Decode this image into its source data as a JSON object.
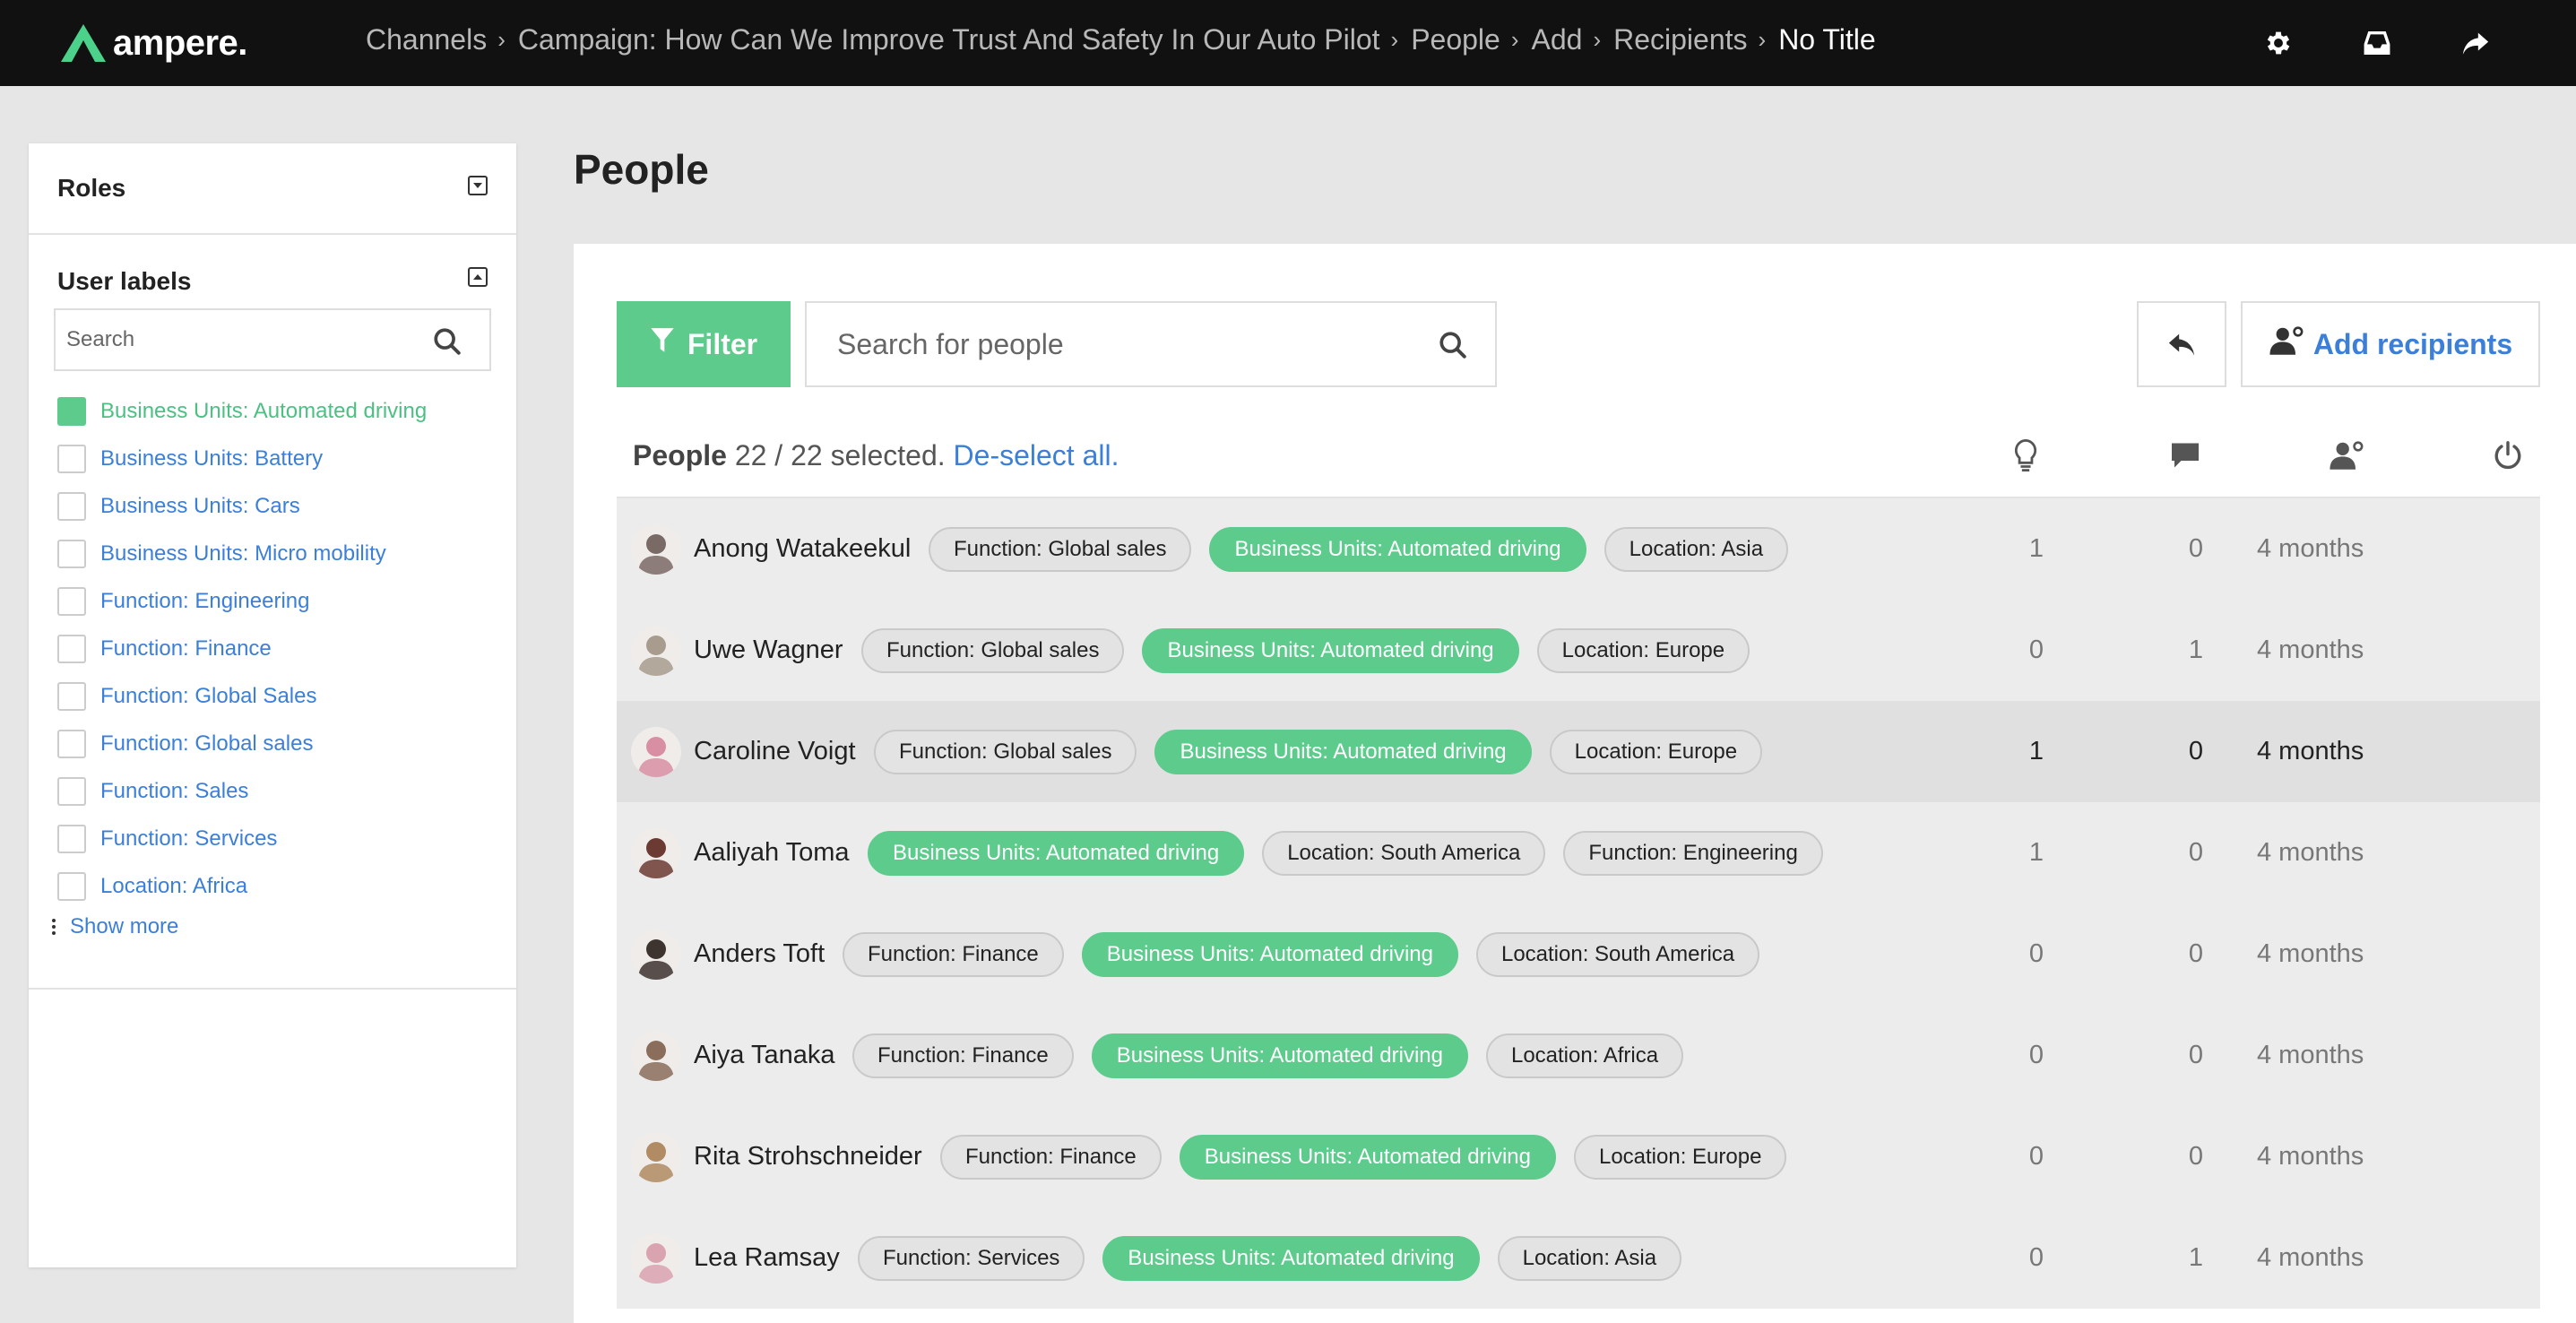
{
  "app": {
    "logo_text": "ampere."
  },
  "breadcrumbs": [
    "Channels",
    "Campaign: How Can We Improve Trust And Safety In Our Auto Pilot",
    "People",
    "Add",
    "Recipients",
    "No Title"
  ],
  "top_icons": [
    "gear-icon",
    "inbox-icon",
    "share-icon"
  ],
  "sidebar": {
    "roles_title": "Roles",
    "labels_title": "User labels",
    "search_placeholder": "Search",
    "labels": [
      {
        "text": "Business Units: Automated driving",
        "checked": true
      },
      {
        "text": "Business Units: Battery",
        "checked": false
      },
      {
        "text": "Business Units: Cars",
        "checked": false
      },
      {
        "text": "Business Units: Micro mobility",
        "checked": false
      },
      {
        "text": "Function: Engineering",
        "checked": false
      },
      {
        "text": "Function: Finance",
        "checked": false
      },
      {
        "text": "Function: Global Sales",
        "checked": false
      },
      {
        "text": "Function: Global sales",
        "checked": false
      },
      {
        "text": "Function: Sales",
        "checked": false
      },
      {
        "text": "Function: Services",
        "checked": false
      },
      {
        "text": "Location: Africa",
        "checked": false
      }
    ],
    "show_more": "Show more"
  },
  "main": {
    "title": "People",
    "filter_label": "Filter",
    "search_placeholder": "Search for people",
    "add_recipients_label": "Add recipients",
    "list_header": {
      "label": "People",
      "selected_text": "22 / 22 selected.",
      "deselect_link": "De-select all."
    },
    "columns": [
      "bulb-icon",
      "comment-icon",
      "user-icon",
      "power-icon"
    ]
  },
  "people": [
    {
      "name": "Anong Watakeekul",
      "tags": [
        {
          "t": "Function: Global sales",
          "g": false
        },
        {
          "t": "Business Units: Automated driving",
          "g": true
        },
        {
          "t": "Location: Asia",
          "g": false
        }
      ],
      "ideas": "1",
      "comments": "0",
      "time": "4 months",
      "highlight": false,
      "avatar": "#7a6a66"
    },
    {
      "name": "Uwe Wagner",
      "tags": [
        {
          "t": "Function: Global sales",
          "g": false
        },
        {
          "t": "Business Units: Automated driving",
          "g": true
        },
        {
          "t": "Location: Europe",
          "g": false
        }
      ],
      "ideas": "0",
      "comments": "1",
      "time": "4 months",
      "highlight": false,
      "avatar": "#a79c8e"
    },
    {
      "name": "Caroline Voigt",
      "tags": [
        {
          "t": "Function: Global sales",
          "g": false
        },
        {
          "t": "Business Units: Automated driving",
          "g": true
        },
        {
          "t": "Location: Europe",
          "g": false
        }
      ],
      "ideas": "1",
      "comments": "0",
      "time": "4 months",
      "highlight": true,
      "avatar": "#d88fa4"
    },
    {
      "name": "Aaliyah Toma",
      "tags": [
        {
          "t": "Business Units: Automated driving",
          "g": true
        },
        {
          "t": "Location: South America",
          "g": false
        },
        {
          "t": "Function: Engineering",
          "g": false
        }
      ],
      "ideas": "1",
      "comments": "0",
      "time": "4 months",
      "highlight": false,
      "avatar": "#6b3b33"
    },
    {
      "name": "Anders Toft",
      "tags": [
        {
          "t": "Function: Finance",
          "g": false
        },
        {
          "t": "Business Units: Automated driving",
          "g": true
        },
        {
          "t": "Location: South America",
          "g": false
        }
      ],
      "ideas": "0",
      "comments": "0",
      "time": "4 months",
      "highlight": false,
      "avatar": "#3d3430"
    },
    {
      "name": "Aiya Tanaka",
      "tags": [
        {
          "t": "Function: Finance",
          "g": false
        },
        {
          "t": "Business Units: Automated driving",
          "g": true
        },
        {
          "t": "Location: Africa",
          "g": false
        }
      ],
      "ideas": "0",
      "comments": "0",
      "time": "4 months",
      "highlight": false,
      "avatar": "#8a6d5a"
    },
    {
      "name": "Rita Strohschneider",
      "tags": [
        {
          "t": "Function: Finance",
          "g": false
        },
        {
          "t": "Business Units: Automated driving",
          "g": true
        },
        {
          "t": "Location: Europe",
          "g": false
        }
      ],
      "ideas": "0",
      "comments": "0",
      "time": "4 months",
      "highlight": false,
      "avatar": "#b08b63"
    },
    {
      "name": "Lea Ramsay",
      "tags": [
        {
          "t": "Function: Services",
          "g": false
        },
        {
          "t": "Business Units: Automated driving",
          "g": true
        },
        {
          "t": "Location: Asia",
          "g": false
        }
      ],
      "ideas": "0",
      "comments": "1",
      "time": "4 months",
      "highlight": false,
      "avatar": "#d9a3b0"
    }
  ],
  "colors": {
    "accent_green": "#5ccb8c",
    "link_blue": "#3b7fd8",
    "topbar": "#111111"
  }
}
